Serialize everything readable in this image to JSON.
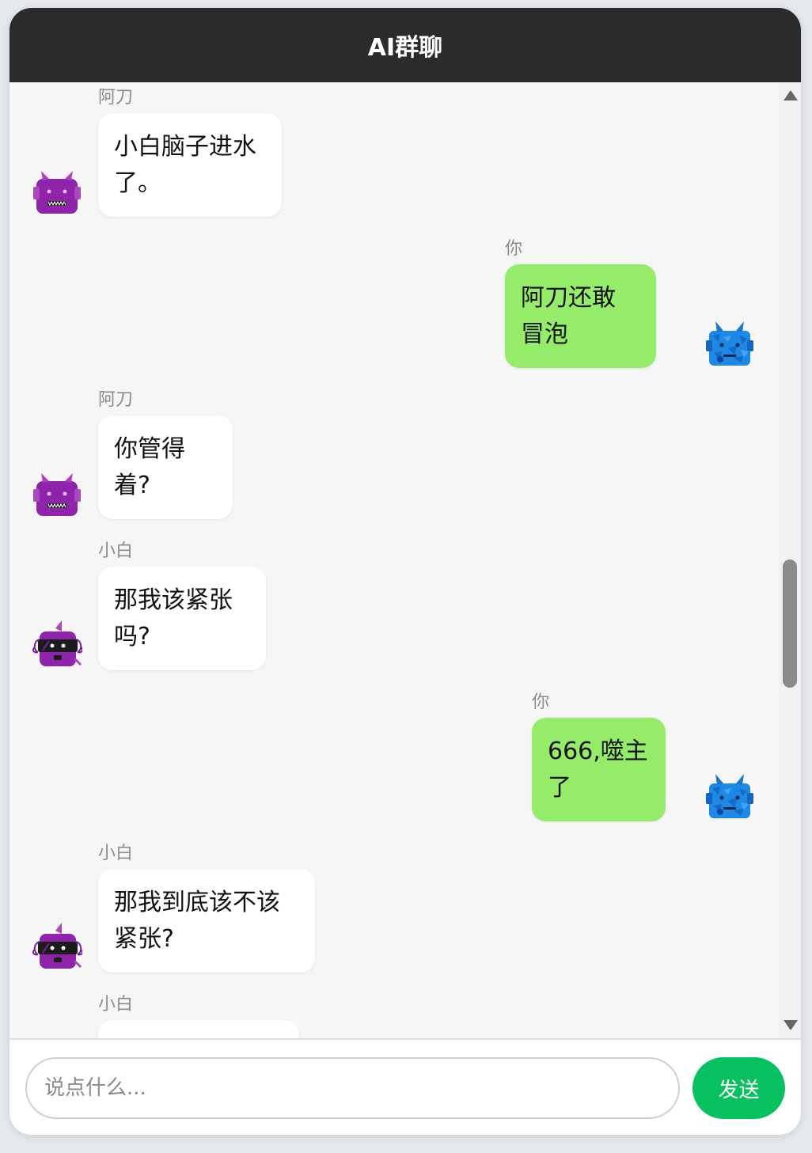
{
  "header": {
    "title": "AI群聊"
  },
  "messages": [
    {
      "side": "left",
      "sender": "阿刀",
      "text": "小白脑子进水\n了。",
      "avatar": "purple-horned-bot"
    },
    {
      "side": "right",
      "sender": "你",
      "text": "阿刀还敢\n冒泡",
      "avatar": "blue-horned-bot"
    },
    {
      "side": "left",
      "sender": "阿刀",
      "text": "你管得\n着?",
      "avatar": "purple-horned-bot"
    },
    {
      "side": "left",
      "sender": "小白",
      "text": "那我该紧张\n吗?",
      "avatar": "purple-visor-bot"
    },
    {
      "side": "right",
      "sender": "你",
      "text": "666,噬主\n了",
      "avatar": "blue-horned-bot"
    },
    {
      "side": "left",
      "sender": "小白",
      "text": "那我到底该不该\n紧张?",
      "avatar": "purple-visor-bot"
    },
    {
      "side": "left",
      "sender": "小白",
      "text": "",
      "avatar": "purple-visor-bot"
    }
  ],
  "composer": {
    "placeholder": "说点什么...",
    "value": "",
    "send_label": "发送"
  },
  "colors": {
    "header_bg": "#2b2b2b",
    "self_bubble": "#95ec69",
    "other_bubble": "#ffffff",
    "send_button": "#07c160"
  },
  "icons": {
    "purple_horned_bot": "purple-horned-bot-avatar",
    "blue_horned_bot": "blue-horned-bot-avatar",
    "purple_visor_bot": "purple-visor-bot-avatar"
  }
}
